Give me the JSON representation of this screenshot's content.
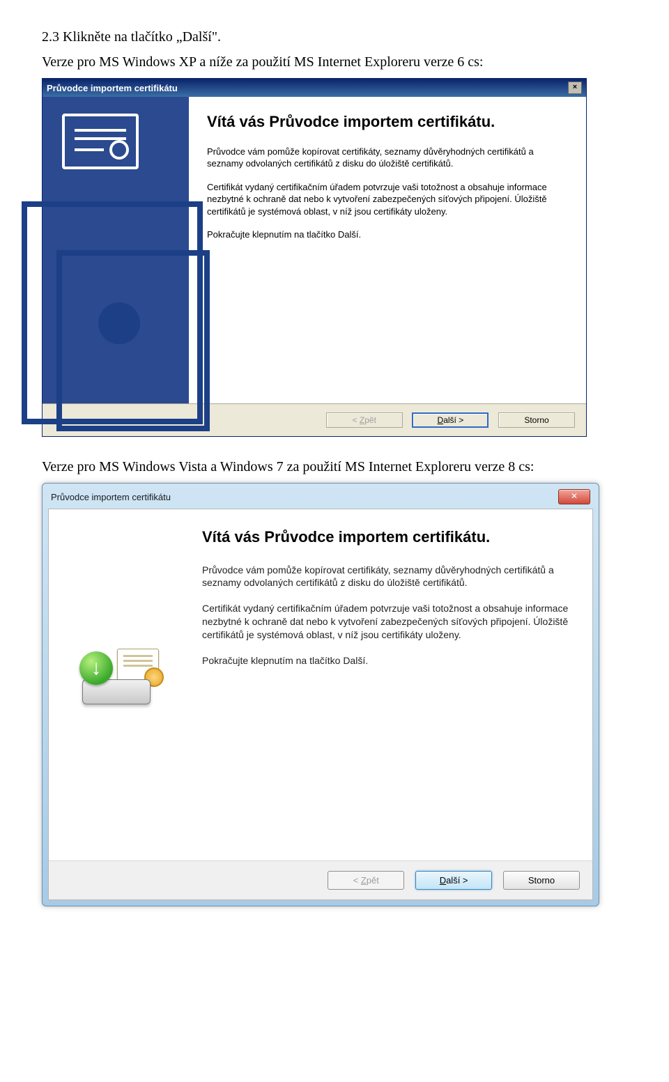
{
  "doc": {
    "line1": "2.3 Klikněte na tlačítko „Další\".",
    "line2": "Verze pro MS Windows XP a níže za použití MS Internet Exploreru verze 6 cs:",
    "line3": "Verze pro MS Windows Vista a Windows 7 za použití MS Internet Exploreru verze 8 cs:"
  },
  "xp": {
    "title": "Průvodce importem certifikátu",
    "heading": "Vítá vás Průvodce importem certifikátu.",
    "p1": "Průvodce vám pomůže kopírovat certifikáty, seznamy důvěryhodných certifikátů a seznamy odvolaných certifikátů z disku do úložiště certifikátů.",
    "p2": "Certifikát vydaný certifikačním úřadem potvrzuje vaši totožnost a obsahuje informace nezbytné k ochraně dat nebo k vytvoření zabezpečených síťových připojení. Úložiště certifikátů je systémová oblast, v níž jsou certifikáty uloženy.",
    "p3": "Pokračujte klepnutím na tlačítko Další.",
    "back": "< Zpět",
    "next": "Další >",
    "cancel": "Storno"
  },
  "w7": {
    "title": "Průvodce importem certifikátu",
    "heading": "Vítá vás Průvodce importem certifikátu.",
    "p1": "Průvodce vám pomůže kopírovat certifikáty, seznamy důvěryhodných certifikátů a seznamy odvolaných certifikátů z disku do úložiště certifikátů.",
    "p2": "Certifikát vydaný certifikačním úřadem potvrzuje vaši totožnost a obsahuje informace nezbytné k ochraně dat nebo k vytvoření zabezpečených síťových připojení. Úložiště certifikátů je systémová oblast, v níž jsou certifikáty uloženy.",
    "p3": "Pokračujte klepnutím na tlačítko Další.",
    "back": "< Zpět",
    "next": "Další >",
    "cancel": "Storno"
  }
}
